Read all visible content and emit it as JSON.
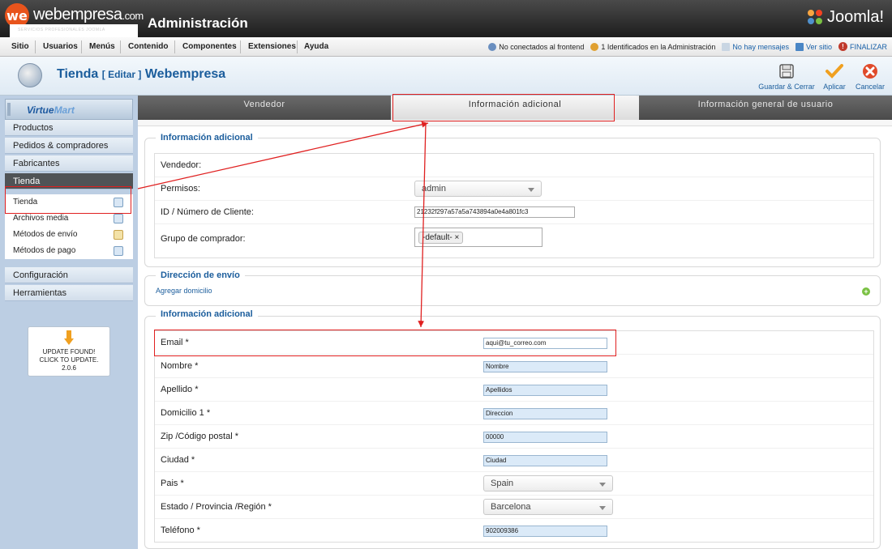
{
  "header": {
    "logo_text": "webempresa",
    "logo_domain": ".com",
    "logo_sub": "SERVICIOS PROFESIONALES JOOMLA",
    "logo_glyph": "we",
    "title": "Administración",
    "joomla_brand": "Joomla!"
  },
  "menubar": {
    "items": [
      "Sitio",
      "Usuarios",
      "Menús",
      "Contenido",
      "Componentes",
      "Extensiones",
      "Ayuda"
    ],
    "status": {
      "frontend": "No conectados al frontend",
      "admin": "1 Identificados en la Administración",
      "messages": "No hay mensajes",
      "view_site": "Ver sitio",
      "logout": "FINALIZAR",
      "logout_glyph": "!"
    }
  },
  "toolbar": {
    "title": "Tienda",
    "edit": "[ Editar ]",
    "name": "Webempresa",
    "buttons": [
      "Guardar & Cerrar",
      "Aplicar",
      "Cancelar"
    ]
  },
  "sidebar": {
    "logo": {
      "prefix": "Virtue",
      "suffix": "Mart"
    },
    "sections": [
      "Productos",
      "Pedidos & compradores",
      "Fabricantes",
      "Tienda"
    ],
    "sub_items": [
      "Tienda",
      "Archivos media",
      "Métodos de envío",
      "Métodos de pago"
    ],
    "bottom_sections": [
      "Configuración",
      "Herramientas"
    ],
    "update": {
      "line1": "UPDATE FOUND!",
      "line2": "CLICK TO UPDATE.",
      "version": "2.0.6",
      "icon": "warning-icon"
    }
  },
  "tabs": [
    "Vendedor",
    "Información adicional",
    "Información general de usuario"
  ],
  "section1": {
    "legend": "Información adicional",
    "rows": {
      "vendor": "Vendedor:",
      "perms_label": "Permisos:",
      "perms_value": "admin",
      "client_label": "ID / Número de Cliente:",
      "client_value": "21232f297a57a5a743894a0e4a801fc3",
      "group_label": "Grupo de comprador:",
      "group_value": "-default-"
    }
  },
  "section2": {
    "legend": "Dirección de envío",
    "link": "Agregar domicilio"
  },
  "section3": {
    "legend": "Información adicional",
    "fields": [
      {
        "label": "Email *",
        "value": "aqui@tu_correo.com"
      },
      {
        "label": "Nombre *",
        "value": "Nombre"
      },
      {
        "label": "Apellido *",
        "value": "Apellidos"
      },
      {
        "label": "Domicilio 1 *",
        "value": "Direccion"
      },
      {
        "label": "Zip /Código postal *",
        "value": "00000"
      },
      {
        "label": "Ciudad *",
        "value": "Ciudad"
      },
      {
        "label": "Pais *",
        "value": "Spain"
      },
      {
        "label": "Estado / Provincia /Región *",
        "value": "Barcelona"
      },
      {
        "label": "Teléfono *",
        "value": "902009386"
      }
    ]
  },
  "colors": {
    "accent": "#1b5d9c",
    "highlight": "#e02020",
    "header": "#1d1d1d"
  }
}
